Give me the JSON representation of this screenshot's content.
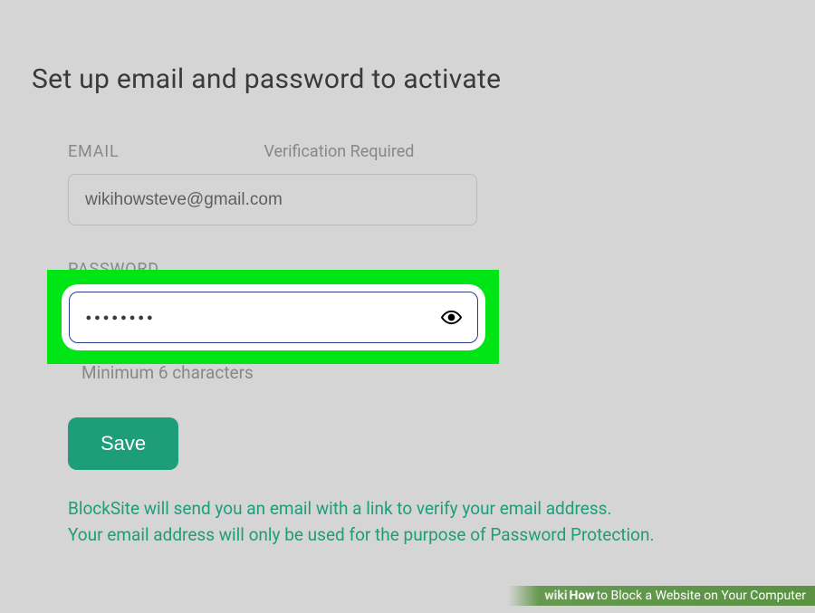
{
  "title": "Set up email and password to activate",
  "email": {
    "label": "EMAIL",
    "verification_label": "Verification Required",
    "value": "wikihowsteve@gmail.com"
  },
  "password": {
    "label": "PASSWORD",
    "masked_value": "●●●●●●●●",
    "helper": "Minimum 6 characters"
  },
  "save_label": "Save",
  "info_line1": "BlockSite will send you an email with a link to verify your email address.",
  "info_line2": "Your email address will only be used for the purpose of Password Protection.",
  "caption": {
    "prefix": "wiki",
    "how": "How",
    "text": " to Block a Website on Your Computer"
  }
}
